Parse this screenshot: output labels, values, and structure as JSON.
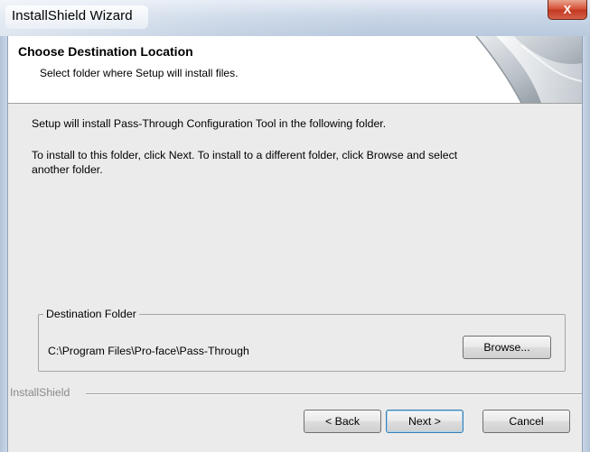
{
  "window": {
    "title": "InstallShield Wizard",
    "close_glyph": "X"
  },
  "header": {
    "title": "Choose Destination Location",
    "subtitle": "Select folder where Setup will install files."
  },
  "body": {
    "line1": "Setup will install Pass-Through Configuration Tool in the following folder.",
    "line2a": "To install to this folder, click Next. To install to a different folder, click Browse and select",
    "line2b": "another folder."
  },
  "destination": {
    "group_label": "Destination Folder",
    "path": "C:\\Program Files\\Pro-face\\Pass-Through",
    "browse_label": "Browse..."
  },
  "footer": {
    "brand": "InstallShield",
    "back_label": "< Back",
    "next_label": "Next >",
    "cancel_label": "Cancel"
  },
  "colors": {
    "client_bg": "#ebebeb",
    "header_bg": "#ffffff",
    "close_red": "#c23a22"
  },
  "icons": [
    "close-icon",
    "page-curl-art"
  ]
}
